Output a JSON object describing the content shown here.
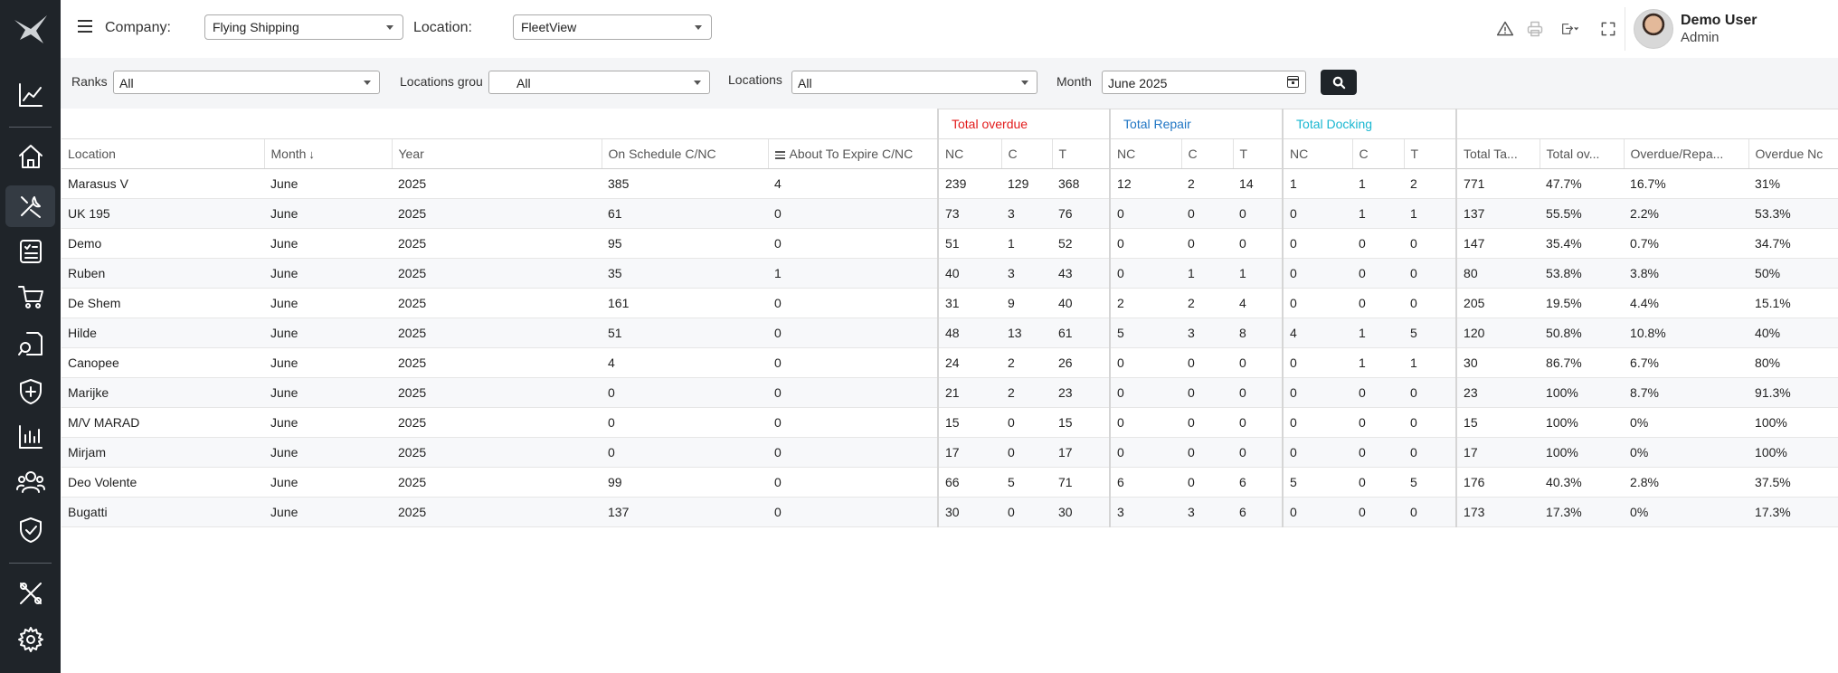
{
  "header": {
    "company_label": "Company:",
    "company_value": "Flying Shipping",
    "location_label": "Location:",
    "location_value": "FleetView",
    "user_name": "Demo User",
    "user_role": "Admin"
  },
  "filters": {
    "ranks_label": "Ranks",
    "ranks_value": "All",
    "location_groups_label": "Locations grou",
    "location_groups_value": "All",
    "locations_label": "Locations",
    "locations_value": "All",
    "month_label": "Month",
    "month_value": "June 2025"
  },
  "table": {
    "groups": {
      "overdue": "Total overdue",
      "repair": "Total Repair",
      "docking": "Total Docking"
    },
    "columns": {
      "location": "Location",
      "month": "Month",
      "year": "Year",
      "on_schedule": "On Schedule C/NC",
      "about_to_expire": "About To Expire C/NC",
      "nc": "NC",
      "c": "C",
      "t": "T",
      "total_tasks": "Total Ta...",
      "total_overdue_pct": "Total ov...",
      "overdue_repair": "Overdue/Repa...",
      "overdue_nc": "Overdue Nc"
    },
    "rows": [
      [
        "Marasus V",
        "June",
        "2025",
        "385",
        "4",
        "239",
        "129",
        "368",
        "12",
        "2",
        "14",
        "1",
        "1",
        "2",
        "771",
        "47.7%",
        "16.7%",
        "31%"
      ],
      [
        "UK 195",
        "June",
        "2025",
        "61",
        "0",
        "73",
        "3",
        "76",
        "0",
        "0",
        "0",
        "0",
        "1",
        "1",
        "137",
        "55.5%",
        "2.2%",
        "53.3%"
      ],
      [
        "Demo",
        "June",
        "2025",
        "95",
        "0",
        "51",
        "1",
        "52",
        "0",
        "0",
        "0",
        "0",
        "0",
        "0",
        "147",
        "35.4%",
        "0.7%",
        "34.7%"
      ],
      [
        "Ruben",
        "June",
        "2025",
        "35",
        "1",
        "40",
        "3",
        "43",
        "0",
        "1",
        "1",
        "0",
        "0",
        "0",
        "80",
        "53.8%",
        "3.8%",
        "50%"
      ],
      [
        "De Shem",
        "June",
        "2025",
        "161",
        "0",
        "31",
        "9",
        "40",
        "2",
        "2",
        "4",
        "0",
        "0",
        "0",
        "205",
        "19.5%",
        "4.4%",
        "15.1%"
      ],
      [
        "Hilde",
        "June",
        "2025",
        "51",
        "0",
        "48",
        "13",
        "61",
        "5",
        "3",
        "8",
        "4",
        "1",
        "5",
        "120",
        "50.8%",
        "10.8%",
        "40%"
      ],
      [
        "Canopee",
        "June",
        "2025",
        "4",
        "0",
        "24",
        "2",
        "26",
        "0",
        "0",
        "0",
        "0",
        "1",
        "1",
        "30",
        "86.7%",
        "6.7%",
        "80%"
      ],
      [
        "Marijke",
        "June",
        "2025",
        "0",
        "0",
        "21",
        "2",
        "23",
        "0",
        "0",
        "0",
        "0",
        "0",
        "0",
        "23",
        "100%",
        "8.7%",
        "91.3%"
      ],
      [
        "M/V MARAD",
        "June",
        "2025",
        "0",
        "0",
        "15",
        "0",
        "15",
        "0",
        "0",
        "0",
        "0",
        "0",
        "0",
        "15",
        "100%",
        "0%",
        "100%"
      ],
      [
        "Mirjam",
        "June",
        "2025",
        "0",
        "0",
        "17",
        "0",
        "17",
        "0",
        "0",
        "0",
        "0",
        "0",
        "0",
        "17",
        "100%",
        "0%",
        "100%"
      ],
      [
        "Deo Volente",
        "June",
        "2025",
        "99",
        "0",
        "66",
        "5",
        "71",
        "6",
        "0",
        "6",
        "5",
        "0",
        "5",
        "176",
        "40.3%",
        "2.8%",
        "37.5%"
      ],
      [
        "Bugatti",
        "June",
        "2025",
        "137",
        "0",
        "30",
        "0",
        "30",
        "3",
        "3",
        "6",
        "0",
        "0",
        "0",
        "173",
        "17.3%",
        "0%",
        "17.3%"
      ]
    ]
  },
  "colors": {
    "sidebar_bg": "#1f2429",
    "overdue_red": "#e21b1b",
    "repair_blue": "#2076c4",
    "docking_cyan": "#19b7d1",
    "on_schedule_green": "#3fa246",
    "about_to_expire_orange": "#f07b07"
  },
  "icons": {
    "sidebar": [
      "logo-bird-icon",
      "chart-line-icon",
      "home-icon",
      "tools-icon",
      "checklist-icon",
      "cart-icon",
      "document-search-icon",
      "shield-plus-icon",
      "bar-chart-icon",
      "users-icon",
      "shield-check-icon",
      "wrench-screwdriver-icon",
      "gear-icon"
    ],
    "header": [
      "menu-icon",
      "warning-icon",
      "print-icon",
      "export-icon",
      "fullscreen-icon",
      "chat-icon"
    ]
  }
}
